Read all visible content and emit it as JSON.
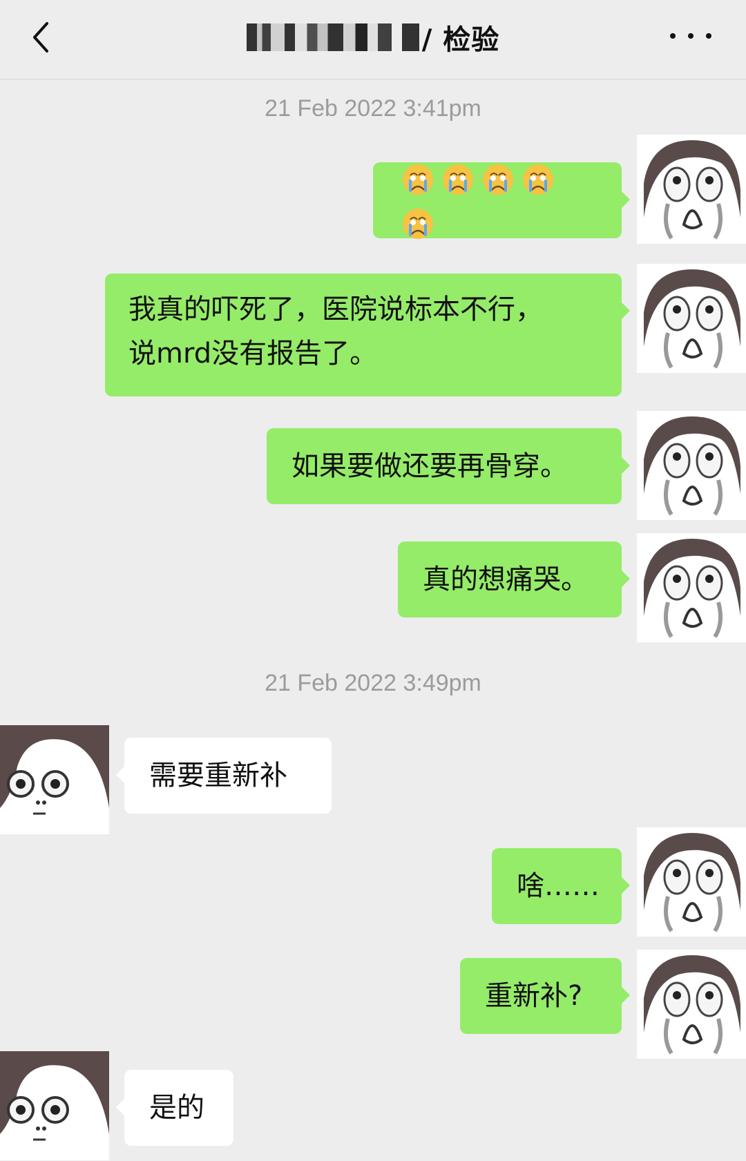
{
  "header": {
    "title": "/ 检验"
  },
  "timestamps": [
    "21 Feb 2022 3:41pm",
    "21 Feb 2022 3:49pm"
  ],
  "messages": [
    {
      "side": "right",
      "text": ""
    },
    {
      "side": "right",
      "text": "我真的吓死了，医院说标本不行，\n说mrd没有报告了。"
    },
    {
      "side": "right",
      "text": "如果要做还要再骨穿。"
    },
    {
      "side": "right",
      "text": "真的想痛哭。"
    },
    {
      "side": "left",
      "text": "需要重新补"
    },
    {
      "side": "right",
      "text": "啥……"
    },
    {
      "side": "right",
      "text": "重新补?"
    },
    {
      "side": "left",
      "text": "是的"
    }
  ],
  "emoji_row": [
    "crying-face-emoji",
    "crying-face-emoji",
    "crying-face-emoji",
    "crying-face-emoji",
    "crying-face-emoji"
  ]
}
